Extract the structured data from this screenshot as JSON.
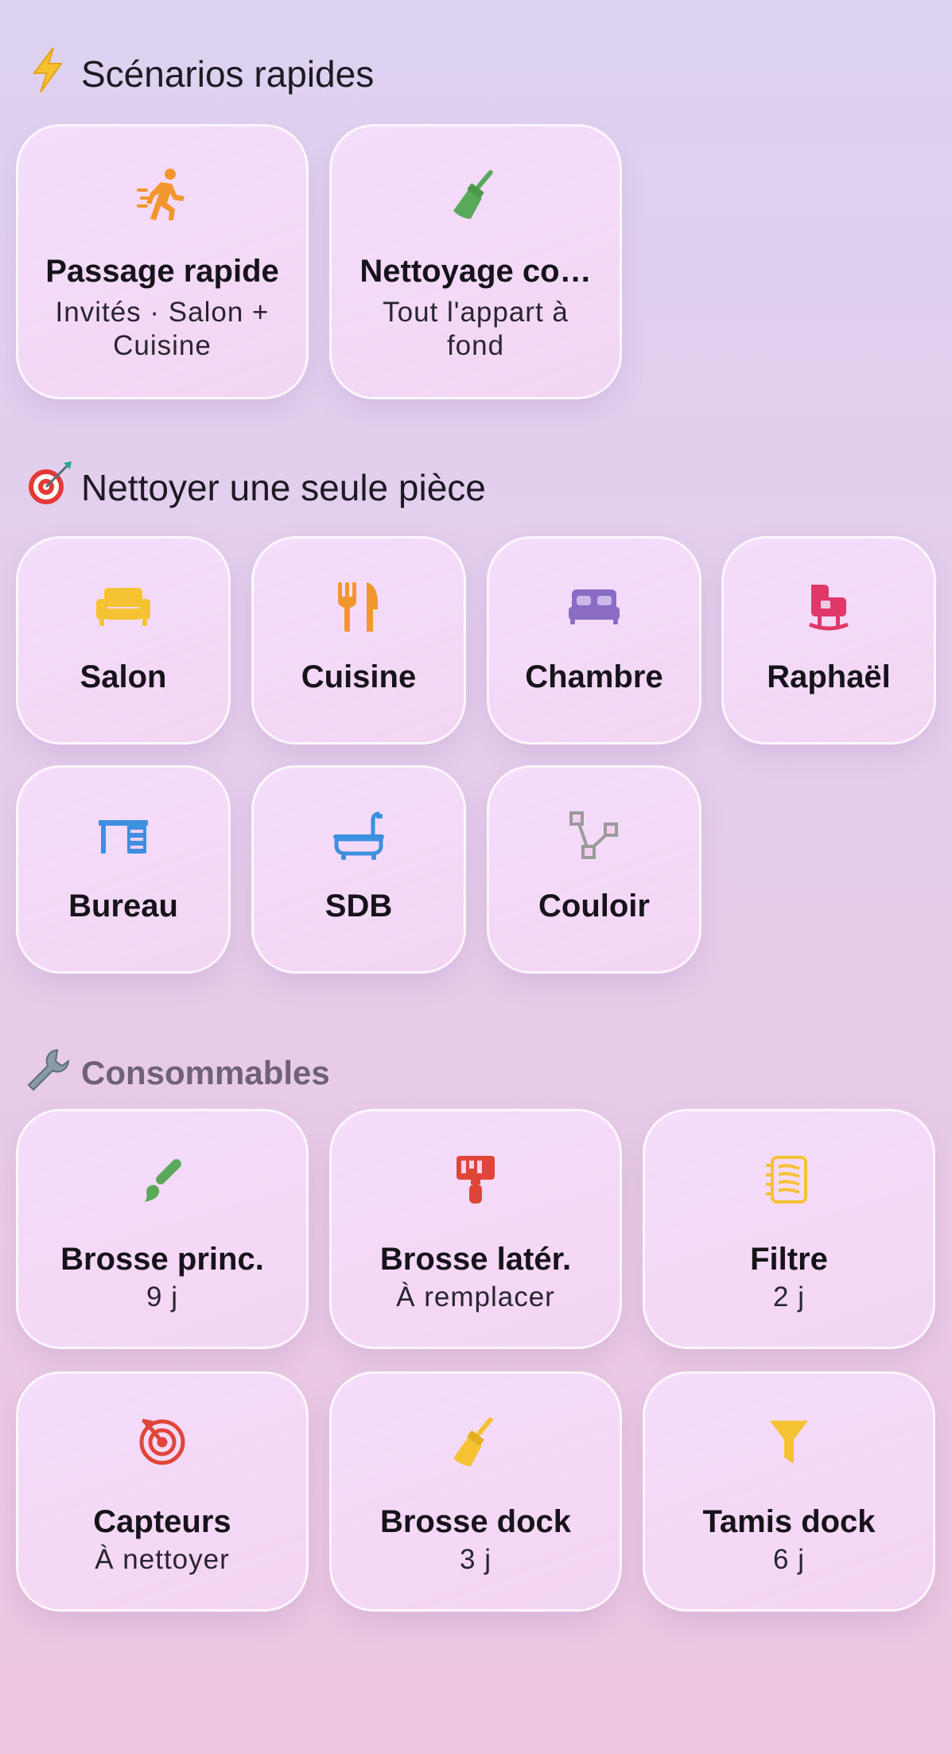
{
  "scenarios": {
    "title": "Scénarios rapides",
    "icon": "lightning-emoji",
    "items": [
      {
        "title": "Passage rapide",
        "sub": "Invités · Salon + Cuisine",
        "icon": "running-person-icon",
        "color": "#f2962e"
      },
      {
        "title": "Nettoyage co…",
        "sub": "Tout l'appart à fond",
        "icon": "broom-icon",
        "color": "#5aa85a"
      }
    ]
  },
  "rooms": {
    "title": "Nettoyer une seule pièce",
    "icon": "target-dart-emoji",
    "items": [
      {
        "title": "Salon",
        "icon": "sofa-icon",
        "color": "#f5c233"
      },
      {
        "title": "Cuisine",
        "icon": "fork-knife-icon",
        "color": "#f2962e"
      },
      {
        "title": "Chambre",
        "icon": "bed-icon",
        "color": "#8a6cc4"
      },
      {
        "title": "Raphaël",
        "icon": "baby-crib-icon",
        "color": "#e0386a"
      },
      {
        "title": "Bureau",
        "icon": "desk-icon",
        "color": "#3d8fe0"
      },
      {
        "title": "SDB",
        "icon": "bathtub-icon",
        "color": "#3d8fe0"
      },
      {
        "title": "Couloir",
        "icon": "hallway-path-icon",
        "color": "#9a9a9a"
      }
    ]
  },
  "consumables": {
    "title": "Consommables",
    "icon": "wrench-emoji",
    "items": [
      {
        "title": "Brosse princ.",
        "sub": "9 j",
        "icon": "brush-icon",
        "color": "#5aa85a"
      },
      {
        "title": "Brosse latér.",
        "sub": "À remplacer",
        "icon": "paint-roller-icon",
        "color": "#e0453a"
      },
      {
        "title": "Filtre",
        "sub": "2 j",
        "icon": "filter-sheet-icon",
        "color": "#f5c233"
      },
      {
        "title": "Capteurs",
        "sub": "À nettoyer",
        "icon": "radar-icon",
        "color": "#e0453a"
      },
      {
        "title": "Brosse dock",
        "sub": "3 j",
        "icon": "broom-icon",
        "color": "#f5c233"
      },
      {
        "title": "Tamis dock",
        "sub": "6 j",
        "icon": "funnel-icon",
        "color": "#f5c233"
      }
    ]
  }
}
